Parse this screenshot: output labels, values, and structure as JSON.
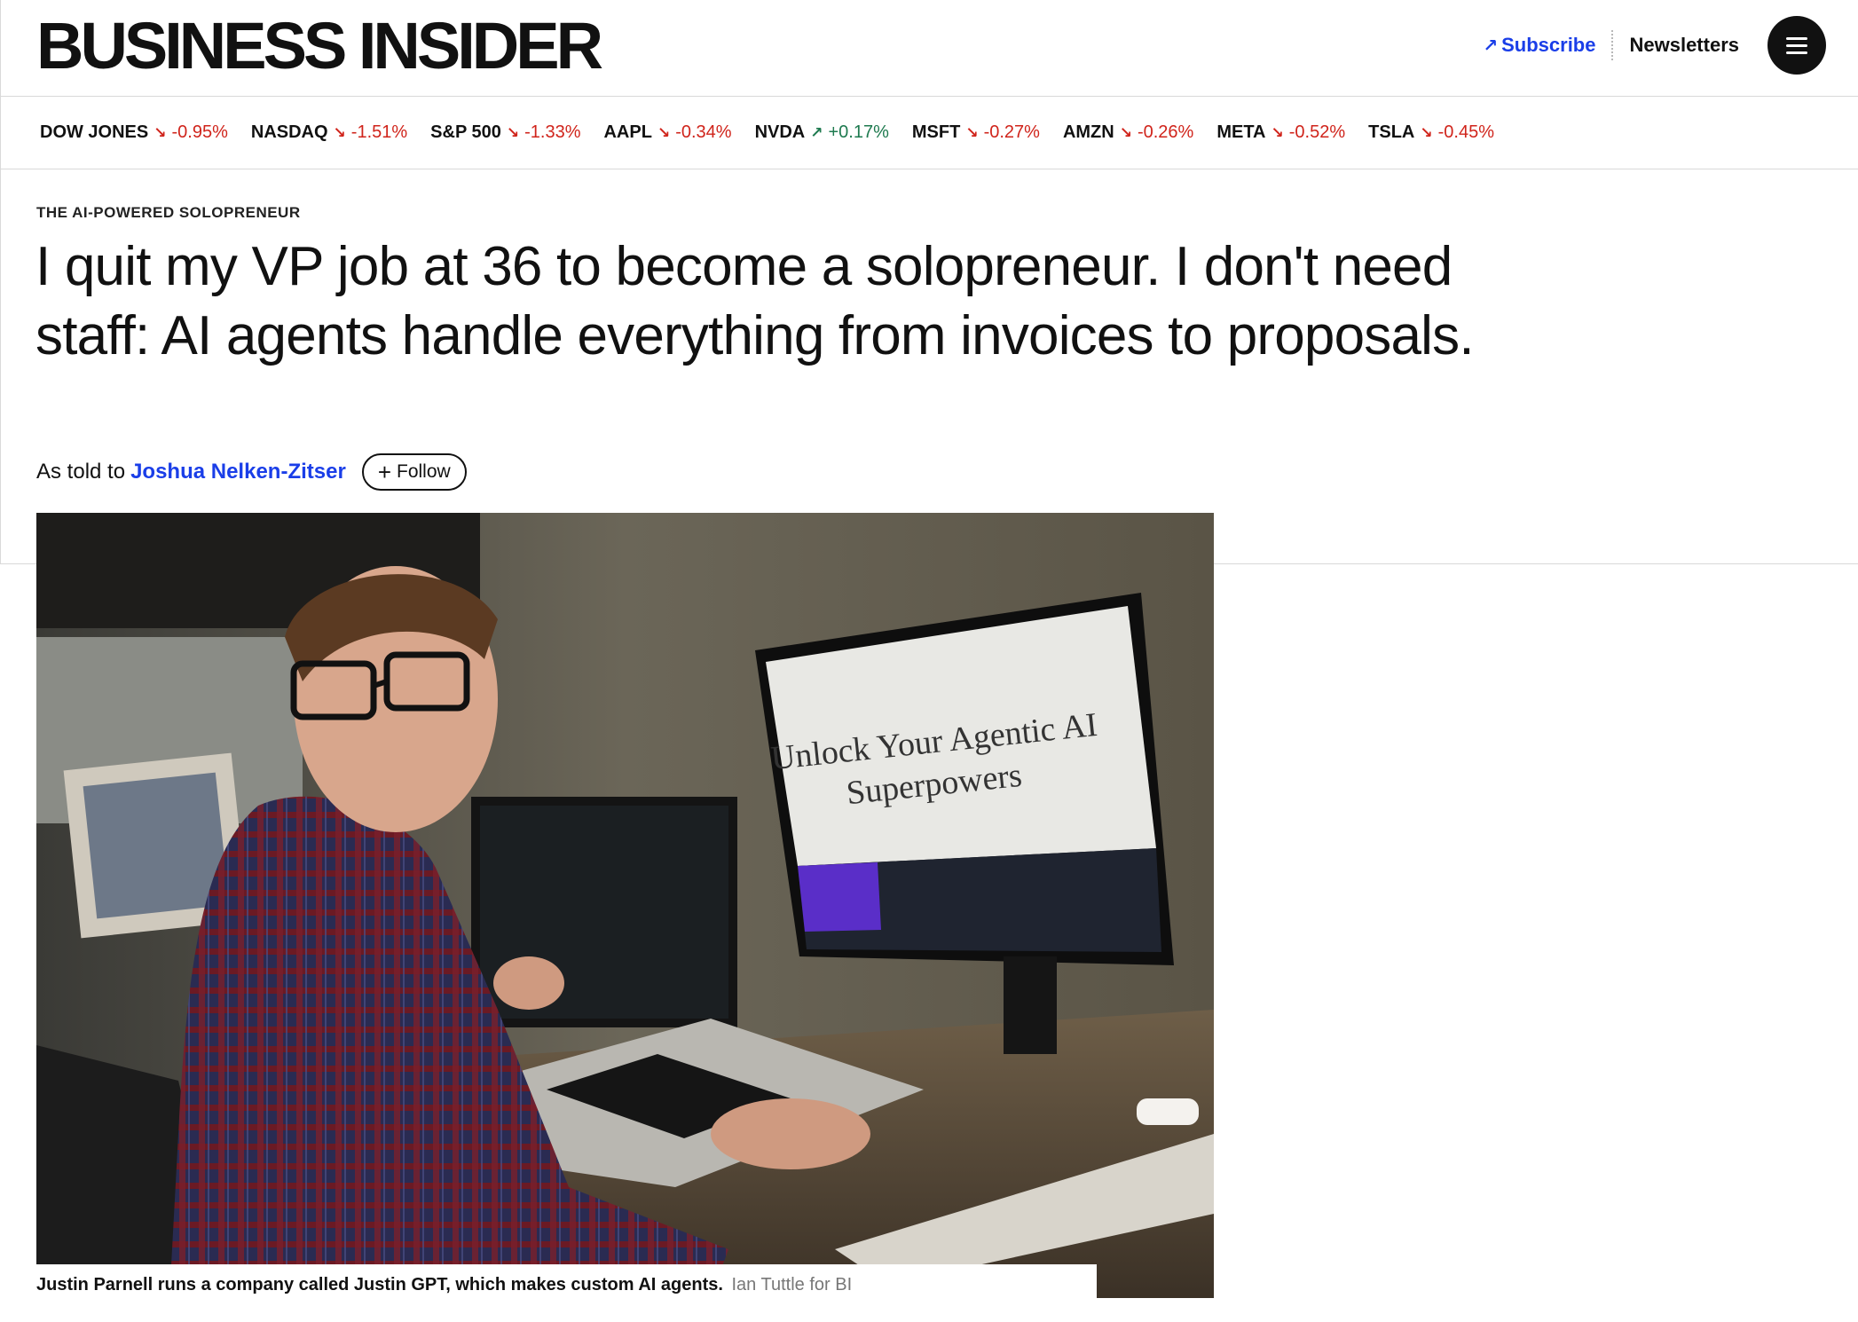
{
  "header": {
    "logo": "BUSINESS INSIDER",
    "subscribe_label": "Subscribe",
    "newsletters_label": "Newsletters"
  },
  "ticker": [
    {
      "symbol": "DOW JONES",
      "change": "-0.95%",
      "direction": "down"
    },
    {
      "symbol": "NASDAQ",
      "change": "-1.51%",
      "direction": "down"
    },
    {
      "symbol": "S&P 500",
      "change": "-1.33%",
      "direction": "down"
    },
    {
      "symbol": "AAPL",
      "change": "-0.34%",
      "direction": "down"
    },
    {
      "symbol": "NVDA",
      "change": "+0.17%",
      "direction": "up"
    },
    {
      "symbol": "MSFT",
      "change": "-0.27%",
      "direction": "down"
    },
    {
      "symbol": "AMZN",
      "change": "-0.26%",
      "direction": "down"
    },
    {
      "symbol": "META",
      "change": "-0.52%",
      "direction": "down"
    },
    {
      "symbol": "TSLA",
      "change": "-0.45%",
      "direction": "down"
    }
  ],
  "article": {
    "kicker": "THE AI-POWERED SOLOPRENEUR",
    "headline": "I quit my VP job at 36 to become a solopreneur. I don't need staff: AI agents handle everything from invoices to proposals.",
    "byline_prefix": "As told to",
    "author": "Joshua Nelken-Zitser",
    "follow_label": "Follow",
    "image_screen_text_line1": "Unlock Your Agentic AI",
    "image_screen_text_line2": "Superpowers",
    "caption": "Justin Parnell runs a company called Justin GPT, which makes custom AI agents.",
    "credit": "Ian Tuttle for BI"
  },
  "colors": {
    "link_blue": "#1a3ee8",
    "down_red": "#d0241b",
    "up_green": "#1e7a4f"
  },
  "icons": [
    "subscribe-arrow-icon",
    "menu-icon",
    "plus-icon",
    "arrow-down-icon",
    "arrow-up-icon"
  ]
}
